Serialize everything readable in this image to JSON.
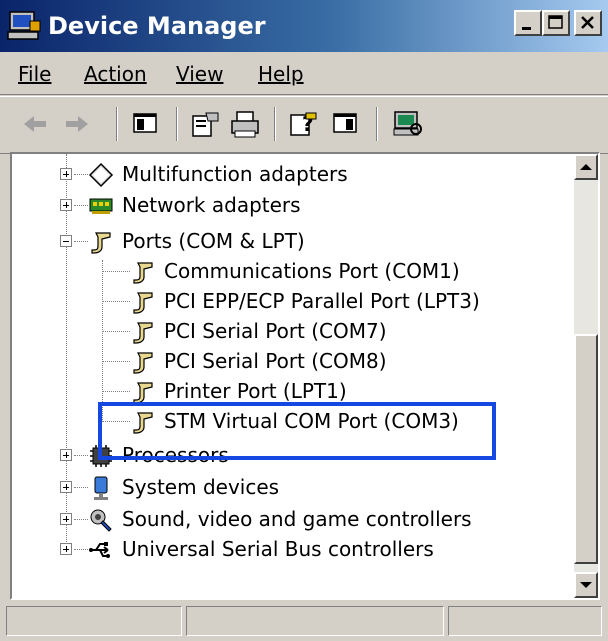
{
  "window": {
    "title": "Device Manager"
  },
  "menu": [
    {
      "label": "File"
    },
    {
      "label": "Action"
    },
    {
      "label": "View"
    },
    {
      "label": "Help"
    }
  ],
  "toolbar": {
    "buttons": [
      "back-icon",
      "forward-icon",
      "show-hide-tree-icon",
      "properties-icon",
      "print-icon",
      "help-icon",
      "console-view-icon",
      "scan-hardware-icon"
    ]
  },
  "tree": {
    "items": [
      {
        "label": "Multifunction adapters",
        "icon": "multifunction-icon",
        "expanded": false
      },
      {
        "label": "Network adapters",
        "icon": "network-adapter-icon",
        "expanded": false
      },
      {
        "label": "Ports (COM & LPT)",
        "icon": "port-icon",
        "expanded": true
      },
      {
        "label": "Communications Port (COM1)",
        "icon": "port-icon"
      },
      {
        "label": "PCI EPP/ECP Parallel Port (LPT3)",
        "icon": "port-icon"
      },
      {
        "label": "PCI Serial Port (COM7)",
        "icon": "port-icon"
      },
      {
        "label": "PCI Serial Port (COM8)",
        "icon": "port-icon"
      },
      {
        "label": "Printer Port (LPT1)",
        "icon": "port-icon"
      },
      {
        "label": "STM Virtual COM Port (COM3)",
        "icon": "port-icon",
        "highlighted": true
      },
      {
        "label": "Processors",
        "icon": "processor-icon",
        "expanded": false
      },
      {
        "label": "System devices",
        "icon": "system-device-icon",
        "expanded": false
      },
      {
        "label": "Sound, video and game controllers",
        "icon": "sound-icon",
        "expanded": false
      },
      {
        "label": "Universal Serial Bus controllers",
        "icon": "usb-icon",
        "expanded": false
      }
    ]
  },
  "colors": {
    "title_start": "#0a246a",
    "title_end": "#a6caf0",
    "highlight": "#1448e0",
    "chrome": "#d4d0c8"
  }
}
